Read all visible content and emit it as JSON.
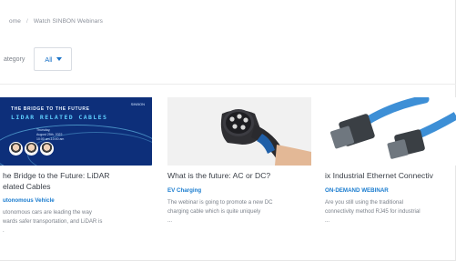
{
  "breadcrumb": {
    "home": "ome",
    "separator": "/",
    "current": "Watch SINBON Webinars"
  },
  "filter": {
    "label": "ategory",
    "value": "All"
  },
  "cards": [
    {
      "title_lines": [
        "he Bridge to the Future: LiDAR",
        "elated Cables"
      ],
      "tag": "utonomous Vehicle",
      "desc_lines": [
        "utonomous cars are leading the way",
        "wards safer transportation, and LiDAR is",
        "."
      ],
      "art": {
        "headline_1": "THE BRIDGE TO THE FUTURE",
        "headline_2": "LIDAR RELATED CABLES",
        "meta": [
          "Thursday,",
          "August 25th, 2022",
          "10:00 am-10:40 am"
        ],
        "brand": "SINBON"
      }
    },
    {
      "title_lines": [
        "What is the future: AC or DC?"
      ],
      "tag": "EV Charging",
      "desc_lines": [
        "The webinar is going to promote a new DC",
        "charging cable which is quite uniquely",
        "..."
      ]
    },
    {
      "title_lines": [
        "ix Industrial Ethernet Connectiv"
      ],
      "tag": "ON-DEMAND WEBINAR",
      "desc_lines": [
        "Are you still using the traditional",
        "connectivity method RJ45 for industrial",
        "..."
      ]
    }
  ],
  "colors": {
    "accent": "#1a7ccf",
    "text": "#3a3f47",
    "muted": "#7c828b"
  }
}
